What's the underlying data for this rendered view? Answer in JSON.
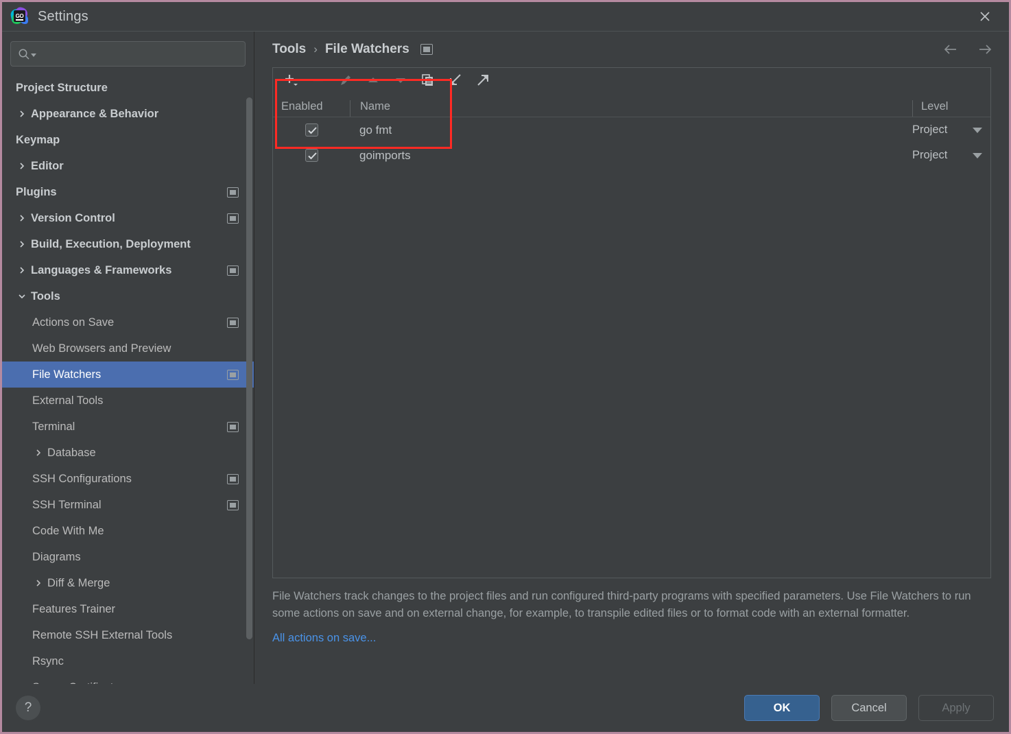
{
  "window": {
    "title": "Settings",
    "logo_icon": "goland-logo-icon",
    "close_icon": "close-icon",
    "border_color": "#b58aa0"
  },
  "sidebar": {
    "search": {
      "value": "",
      "placeholder": "",
      "icon": "search-icon"
    },
    "items": [
      {
        "label": "Project Structure",
        "level": 0,
        "chevron": "",
        "badge": false,
        "selected": false
      },
      {
        "label": "Appearance & Behavior",
        "level": 0,
        "chevron": "right",
        "badge": false,
        "selected": false
      },
      {
        "label": "Keymap",
        "level": 0,
        "chevron": "",
        "badge": false,
        "selected": false
      },
      {
        "label": "Editor",
        "level": 0,
        "chevron": "right",
        "badge": false,
        "selected": false
      },
      {
        "label": "Plugins",
        "level": 0,
        "chevron": "",
        "badge": true,
        "selected": false
      },
      {
        "label": "Version Control",
        "level": 0,
        "chevron": "right",
        "badge": true,
        "selected": false
      },
      {
        "label": "Build, Execution, Deployment",
        "level": 0,
        "chevron": "right",
        "badge": false,
        "selected": false
      },
      {
        "label": "Languages & Frameworks",
        "level": 0,
        "chevron": "right",
        "badge": true,
        "selected": false
      },
      {
        "label": "Tools",
        "level": 0,
        "chevron": "down",
        "badge": false,
        "selected": false
      },
      {
        "label": "Actions on Save",
        "level": 1,
        "chevron": "",
        "badge": true,
        "selected": false
      },
      {
        "label": "Web Browsers and Preview",
        "level": 1,
        "chevron": "",
        "badge": false,
        "selected": false
      },
      {
        "label": "File Watchers",
        "level": 1,
        "chevron": "",
        "badge": true,
        "selected": true
      },
      {
        "label": "External Tools",
        "level": 1,
        "chevron": "",
        "badge": false,
        "selected": false
      },
      {
        "label": "Terminal",
        "level": 1,
        "chevron": "",
        "badge": true,
        "selected": false
      },
      {
        "label": "Database",
        "level": 1,
        "chevron": "right",
        "badge": false,
        "selected": false
      },
      {
        "label": "SSH Configurations",
        "level": 1,
        "chevron": "",
        "badge": true,
        "selected": false
      },
      {
        "label": "SSH Terminal",
        "level": 1,
        "chevron": "",
        "badge": true,
        "selected": false
      },
      {
        "label": "Code With Me",
        "level": 1,
        "chevron": "",
        "badge": false,
        "selected": false
      },
      {
        "label": "Diagrams",
        "level": 1,
        "chevron": "",
        "badge": false,
        "selected": false
      },
      {
        "label": "Diff & Merge",
        "level": 1,
        "chevron": "right",
        "badge": false,
        "selected": false
      },
      {
        "label": "Features Trainer",
        "level": 1,
        "chevron": "",
        "badge": false,
        "selected": false
      },
      {
        "label": "Remote SSH External Tools",
        "level": 1,
        "chevron": "",
        "badge": false,
        "selected": false
      },
      {
        "label": "Rsync",
        "level": 1,
        "chevron": "",
        "badge": false,
        "selected": false
      },
      {
        "label": "Server Certificates",
        "level": 1,
        "chevron": "",
        "badge": false,
        "selected": false
      }
    ],
    "selected_color": "#4b6eaf"
  },
  "breadcrumb": {
    "parent": "Tools",
    "separator": "›",
    "current": "File Watchers",
    "badge_icon": "project-scope-icon",
    "back_icon": "arrow-left-icon",
    "forward_icon": "arrow-right-icon"
  },
  "toolbar": {
    "buttons": [
      {
        "name": "add-watcher-button",
        "icon": "plus-icon",
        "enabled": true
      },
      {
        "name": "remove-watcher-button",
        "icon": "minus-icon",
        "enabled": false
      },
      {
        "name": "edit-watcher-button",
        "icon": "pencil-icon",
        "enabled": false
      },
      {
        "name": "move-up-button",
        "icon": "arrow-up-icon",
        "enabled": false
      },
      {
        "name": "move-down-button",
        "icon": "arrow-down-icon",
        "enabled": false
      },
      {
        "name": "copy-watcher-button",
        "icon": "copy-icon",
        "enabled": true
      },
      {
        "name": "import-button",
        "icon": "import-arrow-icon",
        "enabled": true
      },
      {
        "name": "export-button",
        "icon": "export-arrow-icon",
        "enabled": true
      }
    ]
  },
  "table": {
    "columns": [
      "Enabled",
      "Name",
      "Level"
    ],
    "rows": [
      {
        "enabled": true,
        "name": "go fmt",
        "level": "Project"
      },
      {
        "enabled": true,
        "name": "goimports",
        "level": "Project"
      }
    ]
  },
  "annotation": {
    "type": "highlight-rectangle",
    "color": "#ff2a24"
  },
  "description": {
    "text": "File Watchers track changes to the project files and run configured third-party programs with specified parameters. Use File Watchers to run some actions on save and on external change, for example, to transpile edited files or to format code with an external formatter.",
    "link_label": "All actions on save...",
    "link_color": "#4a93e8"
  },
  "footer": {
    "help_label": "?",
    "ok_label": "OK",
    "cancel_label": "Cancel",
    "apply_label": "Apply",
    "apply_enabled": false
  }
}
